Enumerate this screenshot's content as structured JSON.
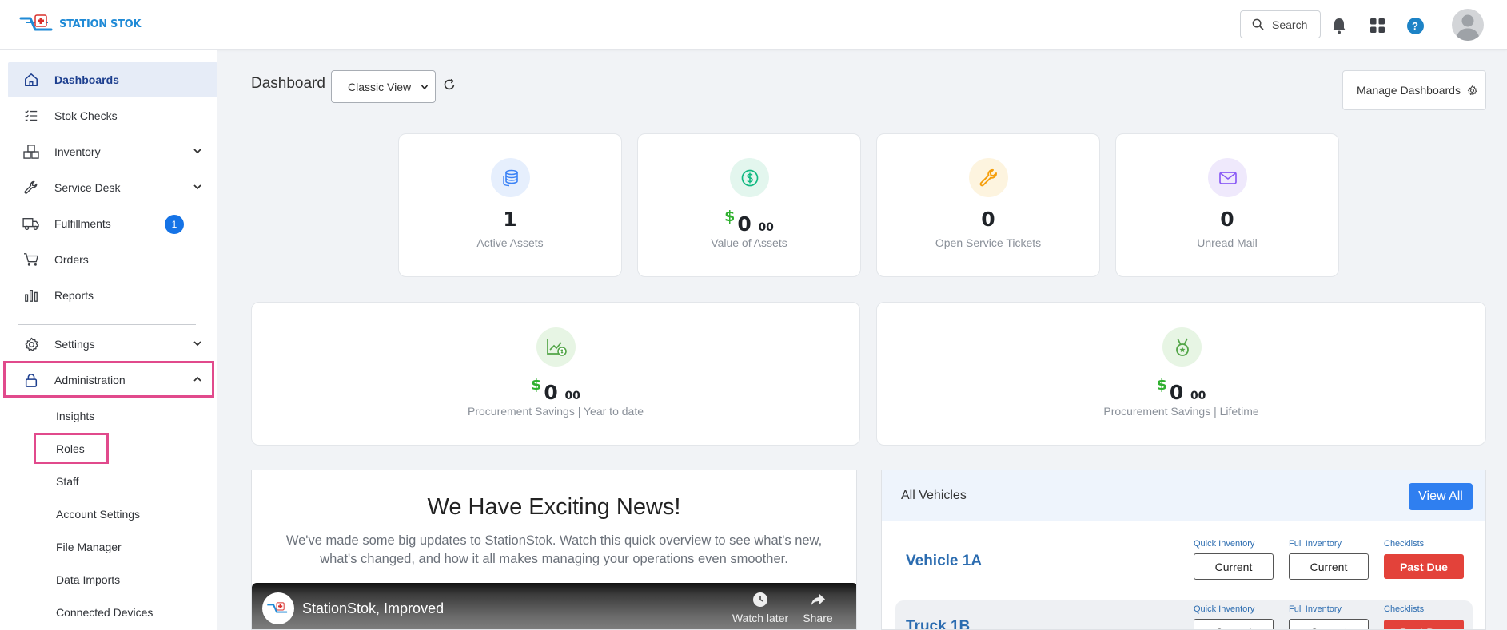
{
  "brand": {
    "name": "STATION STOK"
  },
  "header": {
    "search_label": "Search",
    "help_label": "?"
  },
  "sidebar": {
    "items": [
      {
        "label": "Dashboards",
        "icon": "home-icon"
      },
      {
        "label": "Stok Checks",
        "icon": "checklist-icon"
      },
      {
        "label": "Inventory",
        "icon": "boxes-icon"
      },
      {
        "label": "Service Desk",
        "icon": "wrench-icon"
      },
      {
        "label": "Fulfillments",
        "icon": "truck-icon",
        "badge": "1"
      },
      {
        "label": "Orders",
        "icon": "cart-icon"
      },
      {
        "label": "Reports",
        "icon": "bar-chart-icon"
      },
      {
        "label": "Settings",
        "icon": "gear-icon"
      },
      {
        "label": "Administration",
        "icon": "lock-icon"
      }
    ],
    "admin_sub": [
      "Insights",
      "Roles",
      "Staff",
      "Account Settings",
      "File Manager",
      "Data Imports",
      "Connected Devices"
    ]
  },
  "main": {
    "title": "Dashboard",
    "view_selected": "Classic View",
    "manage_label": "Manage Dashboards",
    "stats": [
      {
        "value": "1",
        "label": "Active Assets",
        "icon": "coins-stack-icon",
        "color": "#3b82f6"
      },
      {
        "currency": "$",
        "value": "0",
        "cents": "00",
        "label": "Value of Assets",
        "icon": "dollar-circle-icon",
        "color": "#10b981"
      },
      {
        "value": "0",
        "label": "Open Service Tickets",
        "icon": "wrench-icon",
        "color": "#f59e0b"
      },
      {
        "value": "0",
        "label": "Unread Mail",
        "icon": "mail-icon",
        "color": "#8b5cf6"
      }
    ],
    "savings": [
      {
        "currency": "$",
        "value": "0",
        "cents": "00",
        "label": "Procurement Savings | Year to date",
        "icon": "savings-chart-icon"
      },
      {
        "currency": "$",
        "value": "0",
        "cents": "00",
        "label": "Procurement Savings | Lifetime",
        "icon": "medal-icon"
      }
    ]
  },
  "news": {
    "title": "We Have Exciting News!",
    "body": "We've made some big updates to StationStok. Watch this quick overview to see what's new, what's changed, and how it all makes managing your operations even smoother.",
    "video_title": "StationStok, Improved",
    "watch_later": "Watch later",
    "share": "Share"
  },
  "vehicles": {
    "title": "All Vehicles",
    "view_all": "View All",
    "col_quick": "Quick Inventory",
    "col_full": "Full Inventory",
    "col_check": "Checklists",
    "rows": [
      {
        "name": "Vehicle 1A",
        "quick": "Current",
        "full": "Current",
        "checklists": "Past Due"
      },
      {
        "name": "Truck 1B",
        "quick": "Current",
        "full": "Current",
        "checklists": "Past Due"
      }
    ]
  },
  "colors": {
    "accent": "#1573e6",
    "highlight": "#e14a8c",
    "danger": "#e3423a",
    "currency": "#2fb02f"
  }
}
